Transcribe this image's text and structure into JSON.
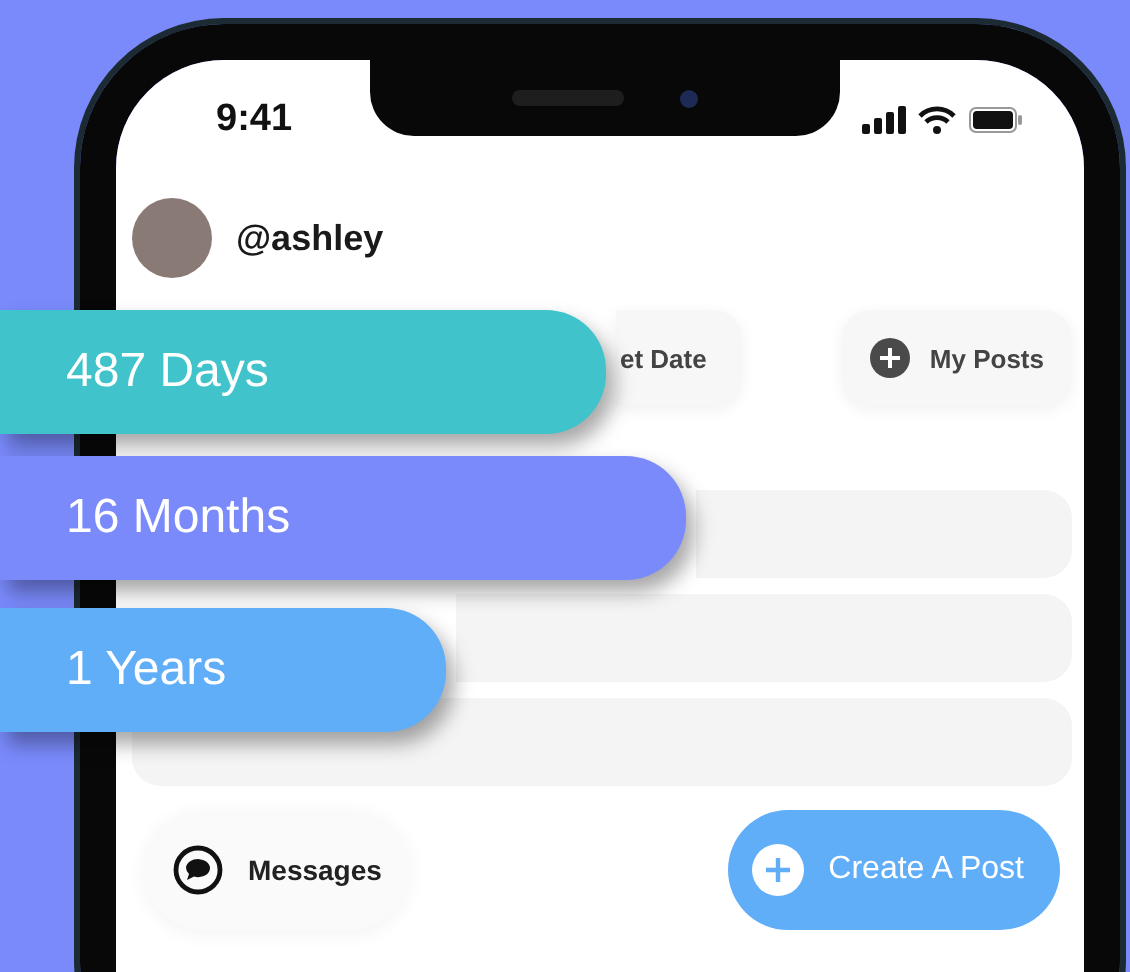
{
  "status_bar": {
    "time": "9:41"
  },
  "profile": {
    "handle": "@ashley"
  },
  "actions": [
    {
      "label": "et Date",
      "kind": "plain"
    },
    {
      "label": "My Posts",
      "kind": "plus"
    }
  ],
  "counters": [
    {
      "text": "487 Days",
      "color": "#40c3cb"
    },
    {
      "text": "16 Months",
      "color": "#7a8afb"
    },
    {
      "text": "1 Years",
      "color": "#60adf8"
    }
  ],
  "bottom_bar": {
    "messages": "Messages",
    "create": "Create A Post"
  }
}
